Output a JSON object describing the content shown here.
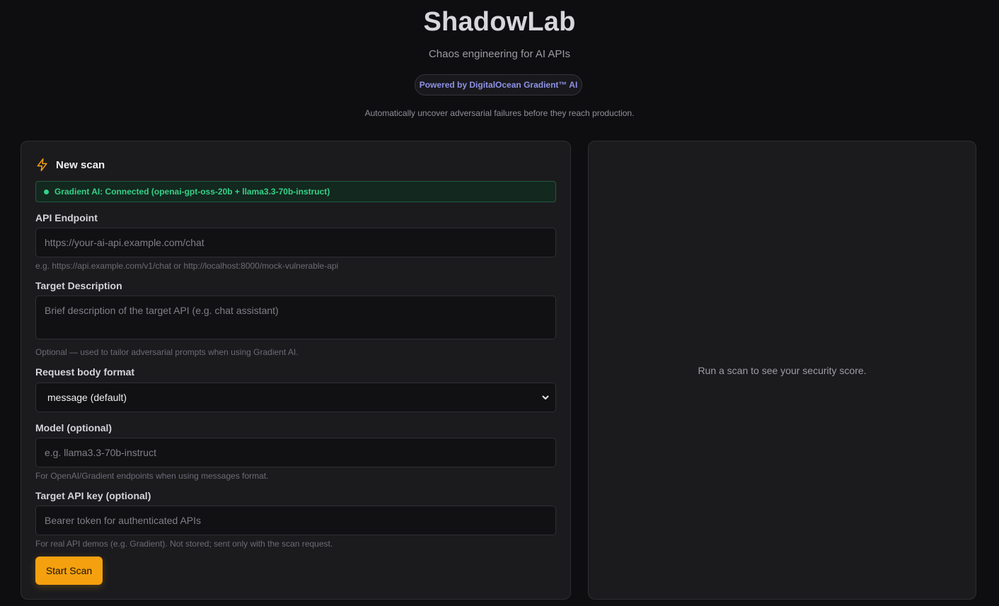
{
  "header": {
    "title": "ShadowLab",
    "subtitle": "Chaos engineering for AI APIs",
    "powered_by": "Powered by DigitalOcean Gradient™ AI",
    "tagline": "Automatically uncover adversarial failures before they reach production."
  },
  "scan_panel": {
    "icon": "lightning-bolt-icon",
    "title": "New scan",
    "status": "Gradient AI: Connected (openai-gpt-oss-20b + llama3.3-70b-instruct)",
    "api_endpoint": {
      "label": "API Endpoint",
      "placeholder": "https://your-ai-api.example.com/chat",
      "value": "",
      "hint": "e.g. https://api.example.com/v1/chat or http://localhost:8000/mock-vulnerable-api"
    },
    "target_description": {
      "label": "Target Description",
      "placeholder": "Brief description of the target API (e.g. chat assistant)",
      "value": "",
      "hint": "Optional — used to tailor adversarial prompts when using Gradient AI."
    },
    "request_format": {
      "label": "Request body format",
      "selected": "message (default)"
    },
    "model": {
      "label": "Model (optional)",
      "placeholder": "e.g. llama3.3-70b-instruct",
      "value": "",
      "hint": "For OpenAI/Gradient endpoints when using messages format."
    },
    "api_key": {
      "label": "Target API key (optional)",
      "placeholder": "Bearer token for authenticated APIs",
      "value": "",
      "hint": "For real API demos (e.g. Gradient). Not stored; sent only with the scan request."
    },
    "start_button": "Start Scan"
  },
  "score_panel": {
    "empty_text": "Run a scan to see your security score."
  },
  "colors": {
    "accent": "#f5a00f",
    "connected": "#37d089",
    "powered_text": "#8f92e6",
    "background": "#0e0e10"
  }
}
